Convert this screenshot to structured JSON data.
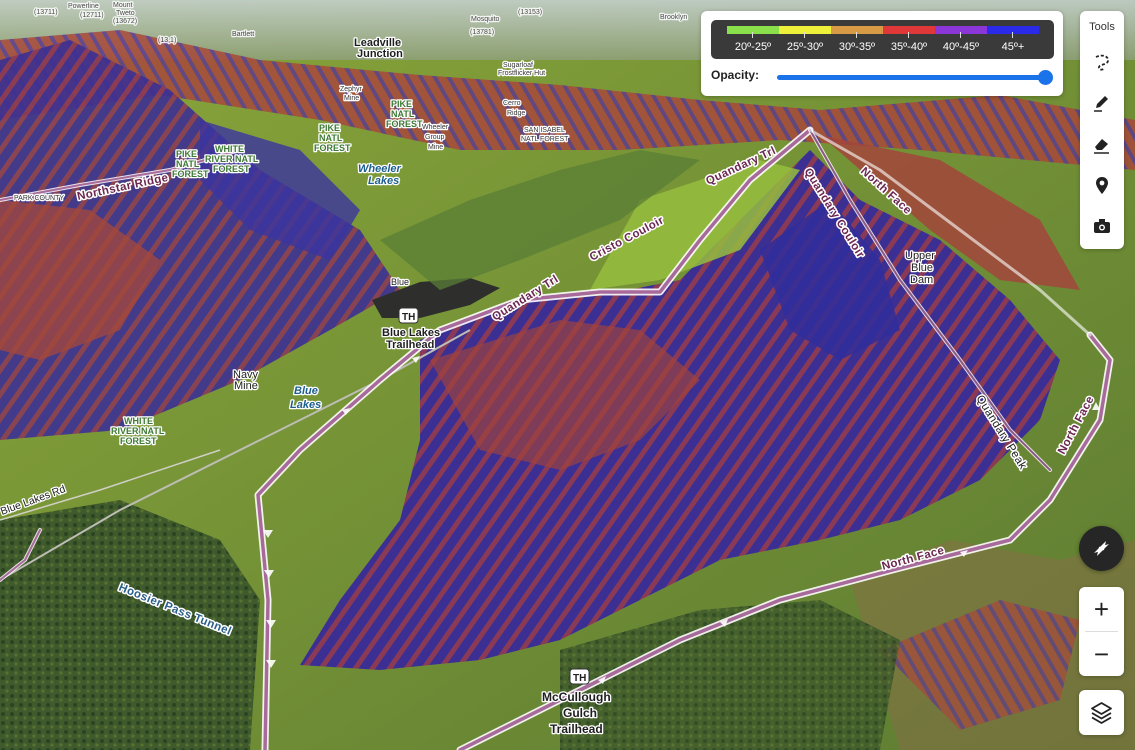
{
  "legend": {
    "ranges": [
      {
        "label": "20º-25º",
        "color": "#8ae04a"
      },
      {
        "label": "25º-30º",
        "color": "#eef03a"
      },
      {
        "label": "30º-35º",
        "color": "#d99a45"
      },
      {
        "label": "35º-40º",
        "color": "#e03838"
      },
      {
        "label": "40º-45º",
        "color": "#8a36d8"
      },
      {
        "label": "45º+",
        "color": "#2a2ae8"
      }
    ]
  },
  "opacity": {
    "label": "Opacity:",
    "value_fraction": 1.0
  },
  "tools": {
    "title": "Tools",
    "items": [
      {
        "name": "lasso-icon"
      },
      {
        "name": "pencil-icon"
      },
      {
        "name": "eraser-icon"
      },
      {
        "name": "map-pin-icon"
      },
      {
        "name": "camera-icon"
      }
    ]
  },
  "zoom": {
    "in_label": "+",
    "out_label": "−"
  },
  "map": {
    "trails": {
      "north_face_upper": "North Face",
      "north_face_lower": "North Face",
      "north_face_right": "North Face",
      "quandary_couloir": "Quandary Couloir",
      "cristo_couloir": "Cristo Couloir",
      "quandary_trl_upper": "Quandary Trl",
      "quandary_trl_lower": "Quandary Trl",
      "quandary_peak": "Quandary Peak",
      "northstar_ridge": "Northstar Ridge",
      "hoosier_tunnel": "Hoosier Pass Tunnel"
    },
    "trailheads": {
      "badge": "TH",
      "blue_lakes_line1": "Blue Lakes",
      "blue_lakes_line2": "Trailhead",
      "mccullough_line1": "McCullough",
      "mccullough_line2": "Gulch",
      "mccullough_line3": "Trailhead"
    },
    "places": {
      "upper_blue_line1": "Upper",
      "upper_blue_line2": "Blue",
      "upper_blue_line3": "Dam",
      "navy_mine_line1": "Navy",
      "navy_mine_line2": "Mine",
      "blue_lakes_water_line1": "Blue",
      "blue_lakes_water_line2": "Lakes",
      "wheeler_lakes_line1": "Wheeler",
      "wheeler_lakes_line2": "Lakes",
      "blue_small": "Blue",
      "blue_lakes_rd": "Blue Lakes Rd",
      "park_county": "PARK COUNTY",
      "leadville_line1": "Leadville",
      "leadville_line2": "Junction",
      "wheeler_mine_line1": "Wheeler",
      "wheeler_mine_line2": "Group",
      "wheeler_mine_line3": "Mine",
      "sugarloaf_line1": "Sugarloaf",
      "sugarloaf_line2": "Frostflicker Hut",
      "zephyr_line1": "Zephyr",
      "zephyr_line2": "Mine",
      "cerro_line1": "Cerro",
      "cerro_line2": "Ridge",
      "mount_line1": "Mount",
      "mount_line2": "Tweto",
      "san_isabel_line1": "SAN ISABEL",
      "san_isabel_line2": "NATL FOREST",
      "pike_a_line1": "PIKE",
      "pike_a_line2": "NATL",
      "pike_a_line3": "FOREST",
      "pike_b_line1": "PIKE",
      "pike_b_line2": "NATL",
      "pike_b_line3": "FOREST",
      "pike_c_line1": "PIKE",
      "pike_c_line2": "NATL",
      "pike_c_line3": "FOREST",
      "wrnf_a_line1": "WHITE",
      "wrnf_a_line2": "RIVER NATL",
      "wrnf_a_line3": "FOREST",
      "wrnf_b_line1": "WHITE",
      "wrnf_b_line2": "RIVER NATL",
      "wrnf_b_line3": "FOREST"
    },
    "top_faint": {
      "t1": "(13711)",
      "t2": "Mount",
      "t3": "Tweto",
      "t4": "(13672)",
      "t5": "(12711)",
      "t6": "Powerline",
      "t7": "Bartlett",
      "t8": "(13,1)",
      "t9": "(13153)",
      "t10": "Mosquito",
      "t11": "(13781)",
      "t12": "Brooklyn"
    }
  }
}
